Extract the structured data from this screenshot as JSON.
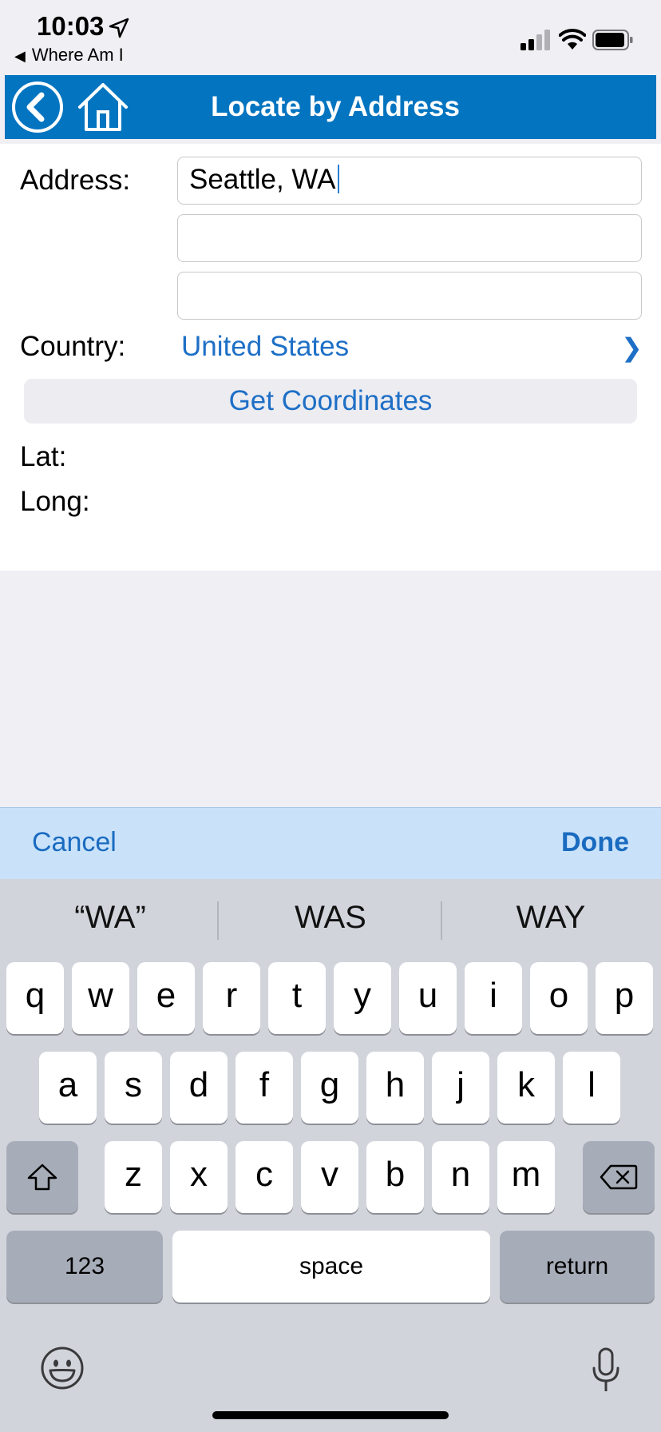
{
  "status_bar": {
    "time": "10:03",
    "back_app": "Where Am I"
  },
  "nav": {
    "title": "Locate by Address"
  },
  "form": {
    "address_label": "Address:",
    "address_line1": "Seattle, WA",
    "address_line2": "",
    "address_line3": "",
    "country_label": "Country:",
    "country_value": "United States",
    "country_chevron": "❯",
    "get_coordinates": "Get Coordinates",
    "lat_label": "Lat:",
    "long_label": "Long:"
  },
  "toolbar": {
    "cancel": "Cancel",
    "done": "Done"
  },
  "keyboard": {
    "suggestions": [
      "“WA”",
      "WAS",
      "WAY"
    ],
    "row1": [
      "q",
      "w",
      "e",
      "r",
      "t",
      "y",
      "u",
      "i",
      "o",
      "p"
    ],
    "row2": [
      "a",
      "s",
      "d",
      "f",
      "g",
      "h",
      "j",
      "k",
      "l"
    ],
    "row3": [
      "z",
      "x",
      "c",
      "v",
      "b",
      "n",
      "m"
    ],
    "numbers_key": "123",
    "space_key": "space",
    "return_key": "return"
  },
  "colors": {
    "nav_blue": "#0274c0",
    "link_blue": "#1e6fc6",
    "toolbar_bg": "#c9e2fa"
  }
}
